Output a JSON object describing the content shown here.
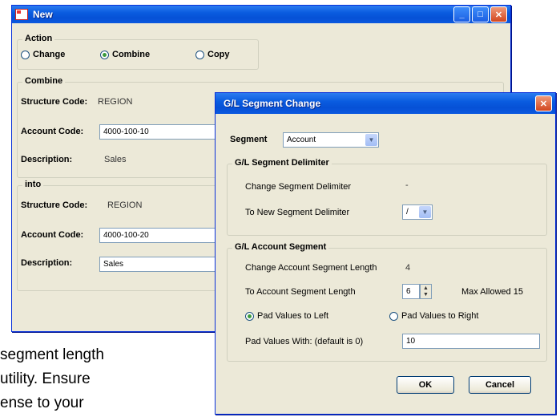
{
  "background_text": [
    "segment length",
    "utility.  Ensure",
    "ense to your"
  ],
  "new_window": {
    "title": "New",
    "action": {
      "legend": "Action",
      "options": [
        "Change",
        "Combine",
        "Copy"
      ],
      "selected": "Combine"
    },
    "combine": {
      "legend": "Combine",
      "structure_label": "Structure Code:",
      "structure_value": "REGION",
      "account_label": "Account Code:",
      "account_value": "4000-100-10",
      "description_label": "Description:",
      "description_value": "Sales"
    },
    "into": {
      "legend": "into",
      "structure_label": "Structure Code:",
      "structure_value": "REGION",
      "account_label": "Account Code:",
      "account_value": "4000-100-20",
      "description_label": "Description:",
      "description_value": "Sales"
    }
  },
  "segment_dialog": {
    "title": "G/L Segment Change",
    "segment_label": "Segment",
    "segment_value": "Account",
    "delimiter": {
      "legend": "G/L Segment Delimiter",
      "change_label": "Change Segment Delimiter",
      "change_value": "-",
      "new_label": "To New Segment Delimiter",
      "new_value": "/"
    },
    "account_segment": {
      "legend": "G/L Account Segment",
      "change_length_label": "Change Account Segment Length",
      "change_length_value": "4",
      "to_length_label": "To Account Segment Length",
      "to_length_value": "6",
      "max_allowed": "Max Allowed 15",
      "pad_left": "Pad Values to Left",
      "pad_right": "Pad Values to Right",
      "pad_with_label": "Pad Values With: (default is 0)",
      "pad_with_value": "10"
    },
    "ok_label": "OK",
    "cancel_label": "Cancel"
  }
}
